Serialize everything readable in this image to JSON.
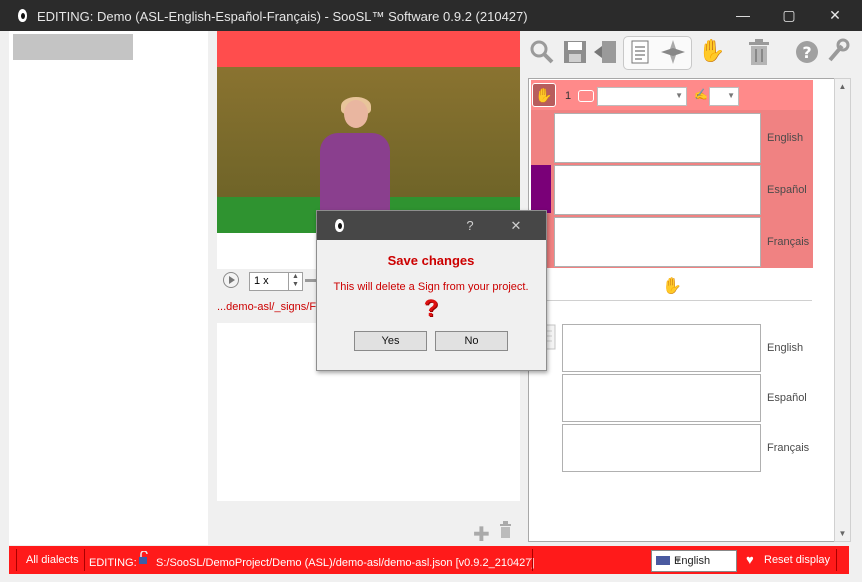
{
  "window": {
    "title": "EDITING: Demo (ASL-English-Español-Français) - SooSL™ Software 0.9.2 (210427)",
    "minimize_glyph": "—",
    "maximize_glyph": "▢",
    "close_glyph": "✕"
  },
  "player": {
    "speed": "1 x"
  },
  "video_path": "...demo-asl/_signs/F#",
  "toolbar": {
    "icons": [
      "search-icon",
      "save-icon",
      "exit-door-icon",
      "details-view-icon",
      "compass-icon",
      "hand-icon",
      "delete-icon",
      "help-icon",
      "settings-wrench-icon"
    ]
  },
  "sign": {
    "number": "1",
    "gloss_languages": [
      "English",
      "Español",
      "Français"
    ],
    "sense_languages": [
      "English",
      "Español",
      "Français"
    ]
  },
  "dialog": {
    "heading": "Save changes",
    "message": "This will delete a Sign from your project.",
    "question_mark": "?",
    "help_glyph": "?",
    "close_glyph": "✕",
    "yes_label": "Yes",
    "no_label": "No"
  },
  "statusbar": {
    "dialects": "All dialects",
    "editing_label": "EDITING:",
    "project_path": "S:/SooSL/DemoProject/Demo (ASL)/demo-asl/demo-asl.json [v0.9.2_210427]",
    "display_language": "English",
    "reset_display": "Reset display"
  },
  "colors": {
    "accent_red": "#ff1a1a",
    "sign_pink": "#f08282",
    "dialog_text_red": "#cc0000",
    "dialect_purple": "#7a0078"
  }
}
